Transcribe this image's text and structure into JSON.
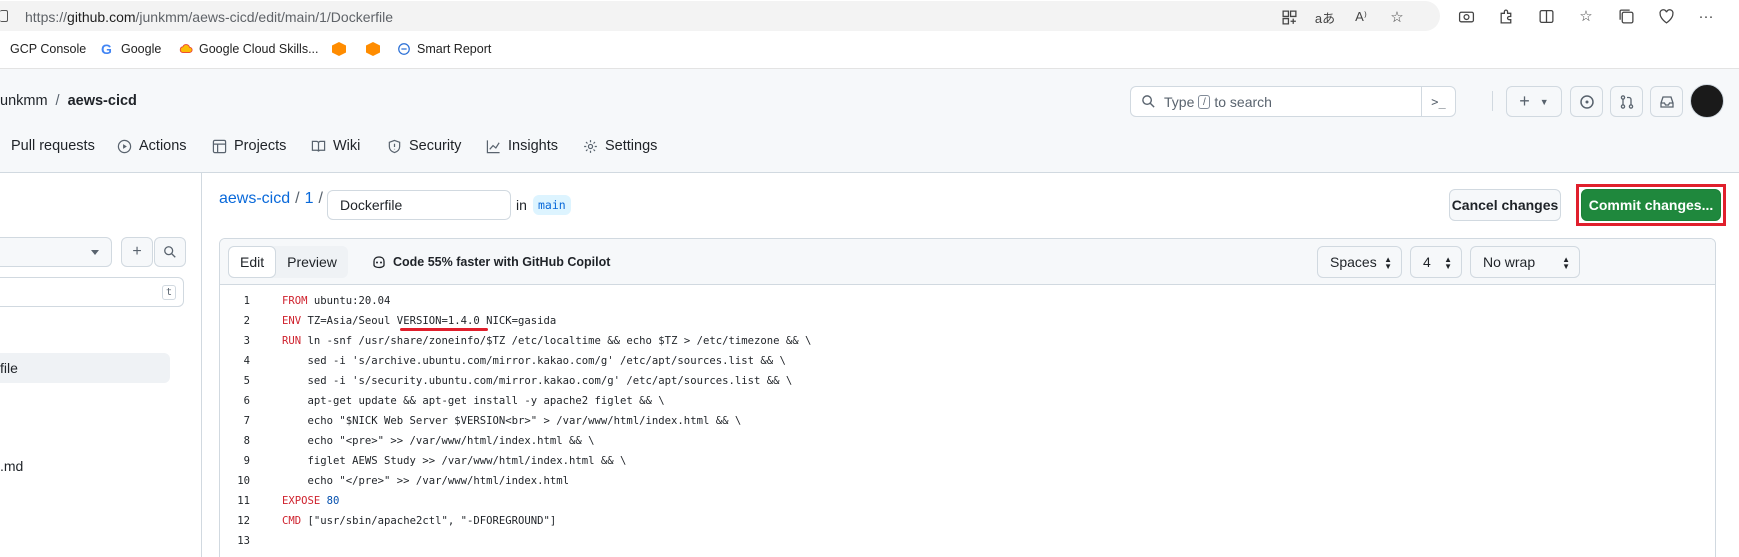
{
  "browser": {
    "url_prefix": "https://",
    "url_domain": "github.com",
    "url_path": "/junkmm/aews-cicd/edit/main/1/Dockerfile",
    "bookmarks": [
      "GCP Console",
      "Google",
      "Google Cloud Skills...",
      "Smart Report"
    ]
  },
  "header": {
    "owner": "unkmm",
    "separator": "/",
    "repo": "aews-cicd",
    "search_placeholder": "Type",
    "search_key": "/",
    "search_suffix": "to search",
    "cmd_icon": ">_"
  },
  "repo_nav": [
    {
      "label": "Pull requests",
      "icon": "pull-request-icon"
    },
    {
      "label": "Actions",
      "icon": "play-icon"
    },
    {
      "label": "Projects",
      "icon": "table-icon"
    },
    {
      "label": "Wiki",
      "icon": "book-icon"
    },
    {
      "label": "Security",
      "icon": "shield-icon"
    },
    {
      "label": "Insights",
      "icon": "graph-icon"
    },
    {
      "label": "Settings",
      "icon": "gear-icon"
    }
  ],
  "sidebar": {
    "filter_key": "t",
    "items": [
      "file",
      ".md"
    ]
  },
  "editor_header": {
    "repo_link": "aews-cicd",
    "folder_link": "1",
    "separator": "/",
    "filename": "Dockerfile",
    "in_label": "in",
    "branch": "main",
    "cancel_label": "Cancel changes",
    "commit_label": "Commit changes..."
  },
  "editor": {
    "tab_edit": "Edit",
    "tab_preview": "Preview",
    "copilot_text": "Code 55% faster with GitHub Copilot",
    "indent_mode": "Spaces",
    "indent_size": "4",
    "wrap_mode": "No wrap",
    "lines": [
      {
        "n": "1",
        "kw": "FROM",
        "rest": " ubuntu:20.04"
      },
      {
        "n": "2",
        "kw": "ENV",
        "rest": " TZ=Asia/Seoul VERSION=1.4.0 NICK=gasida"
      },
      {
        "n": "3",
        "kw": "RUN",
        "rest": " ln -snf /usr/share/zoneinfo/$TZ /etc/localtime && echo $TZ > /etc/timezone && \\"
      },
      {
        "n": "4",
        "kw": "",
        "rest": "    sed -i 's/archive.ubuntu.com/mirror.kakao.com/g' /etc/apt/sources.list && \\"
      },
      {
        "n": "5",
        "kw": "",
        "rest": "    sed -i 's/security.ubuntu.com/mirror.kakao.com/g' /etc/apt/sources.list && \\"
      },
      {
        "n": "6",
        "kw": "",
        "rest": "    apt-get update && apt-get install -y apache2 figlet && \\"
      },
      {
        "n": "7",
        "kw": "",
        "rest": "    echo \"$NICK Web Server $VERSION<br>\" > /var/www/html/index.html && \\"
      },
      {
        "n": "8",
        "kw": "",
        "rest": "    echo \"<pre>\" >> /var/www/html/index.html && \\"
      },
      {
        "n": "9",
        "kw": "",
        "rest": "    figlet AEWS Study >> /var/www/html/index.html && \\"
      },
      {
        "n": "10",
        "kw": "",
        "rest": "    echo \"</pre>\" >> /var/www/html/index.html"
      },
      {
        "n": "11",
        "kw": "EXPOSE",
        "rest": " ",
        "num": "80"
      },
      {
        "n": "12",
        "kw": "CMD",
        "rest": " [\"usr/sbin/apache2ctl\", \"-DFOREGROUND\"]"
      },
      {
        "n": "13",
        "kw": "",
        "rest": ""
      }
    ]
  },
  "colors": {
    "accent_link": "#0969da",
    "commit_green": "#1f883d",
    "highlight_red": "#e01f2c",
    "keyword_red": "#cf222e"
  }
}
